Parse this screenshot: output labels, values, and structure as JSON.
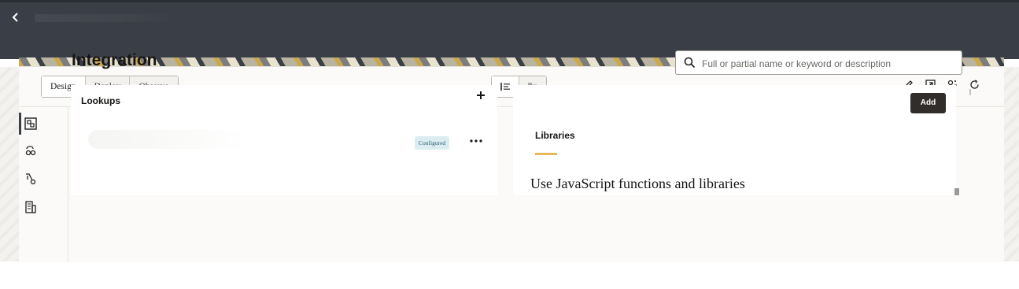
{
  "header": {
    "back_icon": "chevron-left-icon"
  },
  "modes": [
    {
      "label": "Design",
      "active": true
    },
    {
      "label": "Deploy",
      "active": false
    },
    {
      "label": "Observe",
      "active": false
    }
  ],
  "view_toggle": {
    "icons": [
      "list-view-icon",
      "detail-view-icon"
    ]
  },
  "toolbar_icons": [
    "pencil-icon",
    "open-external-icon",
    "users-icon",
    "refresh-icon"
  ],
  "nav_icons": [
    "integration-icon",
    "connections-icon",
    "lookups-icon",
    "libraries-icon"
  ],
  "page": {
    "title": "Integration"
  },
  "search": {
    "placeholder": "Full or partial name or keyword or description"
  },
  "lookups": {
    "title": "Lookups",
    "add_icon": "plus-icon",
    "item": {
      "status": "Configured",
      "actions_icon": "more-icon"
    }
  },
  "right": {
    "add_label": "Add",
    "tab_label": "Libraries",
    "heading": "Use JavaScript functions and libraries",
    "accent": "#e6b85c"
  }
}
